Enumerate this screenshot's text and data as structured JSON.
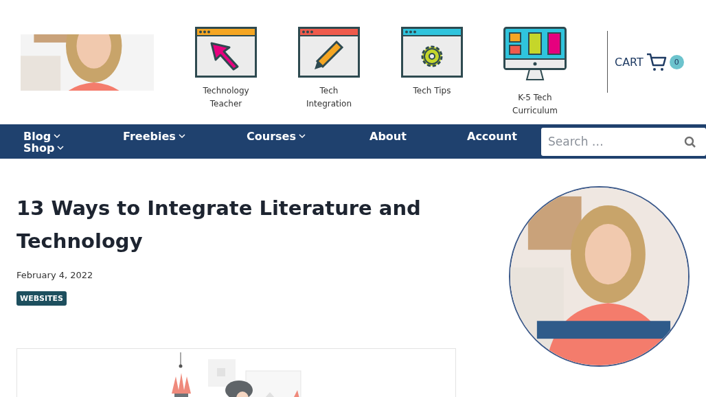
{
  "header": {
    "links": [
      {
        "label": "Technology Teacher",
        "kind": "cursor"
      },
      {
        "label": "Tech Integration",
        "kind": "pencil"
      },
      {
        "label": "Tech Tips",
        "kind": "gear"
      },
      {
        "label": "K-5 Tech Curriculum",
        "kind": "monitor"
      }
    ],
    "cart": {
      "label": "CART",
      "count": "0"
    }
  },
  "nav": {
    "items": [
      {
        "label": "Blog",
        "has_dropdown": true
      },
      {
        "label": "Freebies",
        "has_dropdown": true
      },
      {
        "label": "Courses",
        "has_dropdown": true
      },
      {
        "label": "About",
        "has_dropdown": false
      },
      {
        "label": "Account",
        "has_dropdown": false
      },
      {
        "label": "Shop",
        "has_dropdown": true
      }
    ],
    "search": {
      "placeholder": "Search …"
    }
  },
  "article": {
    "title": "13 Ways to Integrate Literature and Technology",
    "date": "February 4, 2022",
    "category": "WEBSITES"
  }
}
